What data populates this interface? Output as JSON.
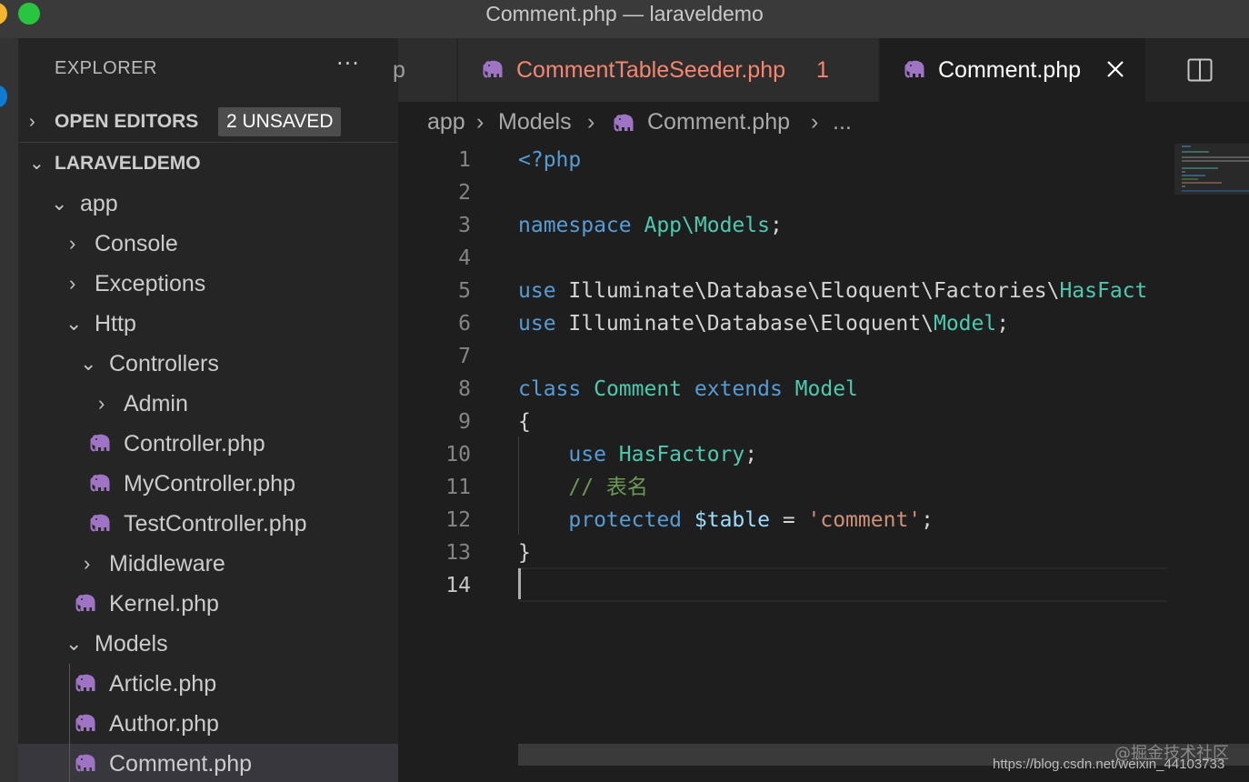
{
  "window": {
    "title": "Comment.php — laraveldemo"
  },
  "sidebar": {
    "header": "EXPLORER",
    "open_editors": {
      "label": "OPEN EDITORS",
      "badge": "2 UNSAVED"
    },
    "project": {
      "label": "LARAVELDEMO"
    },
    "tree": [
      {
        "label": "app",
        "type": "folder",
        "expanded": true
      },
      {
        "label": "Console",
        "type": "folder",
        "expanded": false
      },
      {
        "label": "Exceptions",
        "type": "folder",
        "expanded": false
      },
      {
        "label": "Http",
        "type": "folder",
        "expanded": true
      },
      {
        "label": "Controllers",
        "type": "folder",
        "expanded": true
      },
      {
        "label": "Admin",
        "type": "folder",
        "expanded": false
      },
      {
        "label": "Controller.php",
        "type": "file"
      },
      {
        "label": "MyController.php",
        "type": "file"
      },
      {
        "label": "TestController.php",
        "type": "file"
      },
      {
        "label": "Middleware",
        "type": "folder",
        "expanded": false
      },
      {
        "label": "Kernel.php",
        "type": "file"
      },
      {
        "label": "Models",
        "type": "folder",
        "expanded": true
      },
      {
        "label": "Article.php",
        "type": "file"
      },
      {
        "label": "Author.php",
        "type": "file"
      },
      {
        "label": "Comment.php",
        "type": "file",
        "selected": true
      }
    ]
  },
  "tabs": [
    {
      "label": "p",
      "partial": true
    },
    {
      "label": "CommentTableSeeder.php",
      "problems": "1",
      "color": "#f48771"
    },
    {
      "label": "Comment.php",
      "active": true
    }
  ],
  "breadcrumb": {
    "part1": "app",
    "part2": "Models",
    "part3": "Comment.php",
    "part4": "..."
  },
  "editor": {
    "current_line": "14",
    "lines": [
      {
        "no": "1",
        "tokens": [
          [
            "<?php",
            "kw"
          ]
        ]
      },
      {
        "no": "2",
        "tokens": []
      },
      {
        "no": "3",
        "tokens": [
          [
            "namespace ",
            "kw"
          ],
          [
            "App\\Models",
            "ty"
          ],
          [
            ";",
            "pl"
          ]
        ]
      },
      {
        "no": "4",
        "tokens": []
      },
      {
        "no": "5",
        "tokens": [
          [
            "use ",
            "kw"
          ],
          [
            "Illuminate\\Database\\Eloquent\\Factories\\",
            "pl"
          ],
          [
            "HasFact",
            "ty"
          ]
        ]
      },
      {
        "no": "6",
        "tokens": [
          [
            "use ",
            "kw"
          ],
          [
            "Illuminate\\Database\\Eloquent\\",
            "pl"
          ],
          [
            "Model",
            "ty"
          ],
          [
            ";",
            "pl"
          ]
        ]
      },
      {
        "no": "7",
        "tokens": []
      },
      {
        "no": "8",
        "tokens": [
          [
            "class ",
            "kw"
          ],
          [
            "Comment ",
            "ty"
          ],
          [
            "extends ",
            "kw"
          ],
          [
            "Model",
            "ty"
          ]
        ]
      },
      {
        "no": "9",
        "tokens": [
          [
            "{",
            "pl"
          ]
        ]
      },
      {
        "no": "10",
        "tokens": [
          [
            "    ",
            "pl"
          ],
          [
            "use ",
            "kw"
          ],
          [
            "HasFactory",
            "ty"
          ],
          [
            ";",
            "pl"
          ]
        ]
      },
      {
        "no": "11",
        "tokens": [
          [
            "    ",
            "pl"
          ],
          [
            "// 表名",
            "cm"
          ]
        ]
      },
      {
        "no": "12",
        "tokens": [
          [
            "    ",
            "pl"
          ],
          [
            "protected ",
            "kw"
          ],
          [
            "$table",
            "vr"
          ],
          [
            " = ",
            "pl"
          ],
          [
            "'comment'",
            "st"
          ],
          [
            ";",
            "pl"
          ]
        ]
      },
      {
        "no": "13",
        "tokens": [
          [
            "}",
            "pl"
          ]
        ]
      },
      {
        "no": "14",
        "tokens": []
      }
    ]
  },
  "watermark": {
    "cn": "@掘金技术社区",
    "url": "https://blog.csdn.net/weixin_44103733"
  },
  "colors": {
    "php_icon": "#a074c4",
    "keyword": "#569cd6",
    "type": "#4ec9b0",
    "string": "#ce9178",
    "comment": "#6a9955"
  }
}
